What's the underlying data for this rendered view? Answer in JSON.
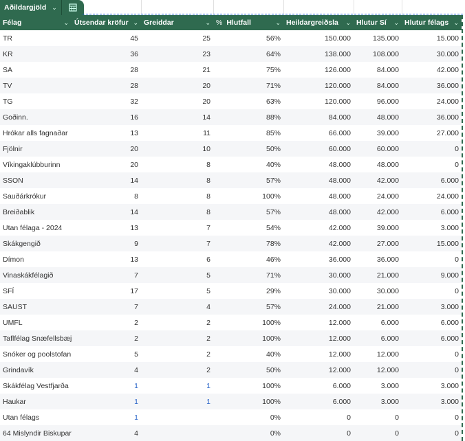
{
  "tab": {
    "label": "Aðildargjöld",
    "calculator_icon": "calculator-icon"
  },
  "columns": [
    "Félag",
    "Útsendar kröfur",
    "Greiddar",
    "Hlutfall",
    "Heildargreiðsla",
    "Hlutur Sí",
    "Hlutur félags"
  ],
  "percent_symbol": "%",
  "rows": [
    [
      "TR",
      "45",
      "25",
      "56%",
      "150.000",
      "135.000",
      "15.000"
    ],
    [
      "KR",
      "36",
      "23",
      "64%",
      "138.000",
      "108.000",
      "30.000"
    ],
    [
      "SA",
      "28",
      "21",
      "75%",
      "126.000",
      "84.000",
      "42.000"
    ],
    [
      "TV",
      "28",
      "20",
      "71%",
      "120.000",
      "84.000",
      "36.000"
    ],
    [
      "TG",
      "32",
      "20",
      "63%",
      "120.000",
      "96.000",
      "24.000"
    ],
    [
      "Goðinn.",
      "16",
      "14",
      "88%",
      "84.000",
      "48.000",
      "36.000"
    ],
    [
      "Hrókar alls fagnaðar",
      "13",
      "11",
      "85%",
      "66.000",
      "39.000",
      "27.000"
    ],
    [
      "Fjölnir",
      "20",
      "10",
      "50%",
      "60.000",
      "60.000",
      "0"
    ],
    [
      "Víkingaklúbburinn",
      "20",
      "8",
      "40%",
      "48.000",
      "48.000",
      "0"
    ],
    [
      "SSON",
      "14",
      "8",
      "57%",
      "48.000",
      "42.000",
      "6.000"
    ],
    [
      "Sauðárkrókur",
      "8",
      "8",
      "100%",
      "48.000",
      "24.000",
      "24.000"
    ],
    [
      "Breiðablik",
      "14",
      "8",
      "57%",
      "48.000",
      "42.000",
      "6.000"
    ],
    [
      "Utan félaga - 2024",
      "13",
      "7",
      "54%",
      "42.000",
      "39.000",
      "3.000"
    ],
    [
      "Skákgengið",
      "9",
      "7",
      "78%",
      "42.000",
      "27.000",
      "15.000"
    ],
    [
      "Dímon",
      "13",
      "6",
      "46%",
      "36.000",
      "36.000",
      "0"
    ],
    [
      "Vinaskákfélagið",
      "7",
      "5",
      "71%",
      "30.000",
      "21.000",
      "9.000"
    ],
    [
      "SFÍ",
      "17",
      "5",
      "29%",
      "30.000",
      "30.000",
      "0"
    ],
    [
      "SAUST",
      "7",
      "4",
      "57%",
      "24.000",
      "21.000",
      "3.000"
    ],
    [
      "UMFL",
      "2",
      "2",
      "100%",
      "12.000",
      "6.000",
      "6.000"
    ],
    [
      "Taflfélag Snæfellsbæjar",
      "2",
      "2",
      "100%",
      "12.000",
      "6.000",
      "6.000"
    ],
    [
      "Snóker og poolstofan",
      "5",
      "2",
      "40%",
      "12.000",
      "12.000",
      "0"
    ],
    [
      "Grindavík",
      "4",
      "2",
      "50%",
      "12.000",
      "12.000",
      "0"
    ],
    [
      "Skákfélag Vestfjarða",
      "1",
      "1",
      "100%",
      "6.000",
      "3.000",
      "3.000"
    ],
    [
      "Haukar",
      "1",
      "1",
      "100%",
      "6.000",
      "3.000",
      "3.000"
    ],
    [
      "Utan félags",
      "1",
      "",
      "0%",
      "0",
      "0",
      "0"
    ],
    [
      "64 Mislyndir Biskupar",
      "4",
      "",
      "0%",
      "0",
      "0",
      "0"
    ]
  ],
  "highlighted_rows": [
    22,
    23,
    24
  ],
  "colors": {
    "header": "#2f6a4f",
    "highlight_text": "#2a64c8",
    "alt_row": "#f5f6f8"
  }
}
